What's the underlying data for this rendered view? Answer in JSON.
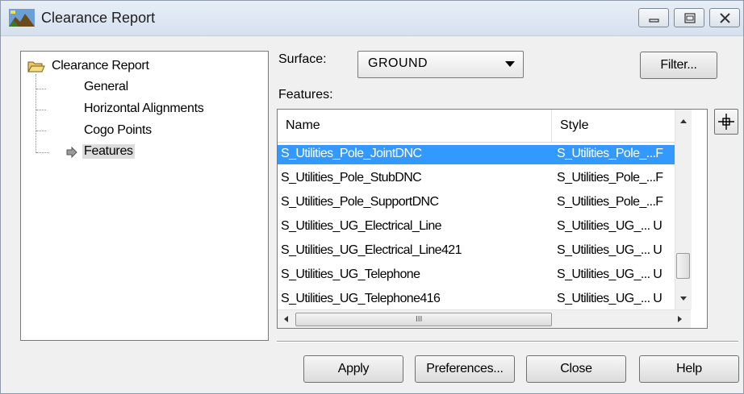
{
  "window": {
    "title": "Clearance Report"
  },
  "tree": {
    "root": "Clearance Report",
    "items": [
      "General",
      "Horizontal Alignments",
      "Cogo Points",
      "Features"
    ],
    "selected": "Features"
  },
  "surface": {
    "label": "Surface:",
    "value": "GROUND"
  },
  "features": {
    "label": "Features:",
    "columns": [
      "Name",
      "Style"
    ],
    "rows": [
      {
        "name": "S_Utilities_Pole_JointDNC",
        "style": "S_Utilities_Pole_...F",
        "selected": true
      },
      {
        "name": "S_Utilities_Pole_StubDNC",
        "style": "S_Utilities_Pole_...F"
      },
      {
        "name": "S_Utilities_Pole_SupportDNC",
        "style": "S_Utilities_Pole_...F"
      },
      {
        "name": "S_Utilities_UG_Electrical_Line",
        "style": "S_Utilities_UG_... U"
      },
      {
        "name": "S_Utilities_UG_Electrical_Line421",
        "style": "S_Utilities_UG_... U"
      },
      {
        "name": "S_Utilities_UG_Telephone",
        "style": "S_Utilities_UG_... U"
      },
      {
        "name": "S_Utilities_UG_Telephone416",
        "style": "S_Utilities_UG_... U"
      }
    ]
  },
  "buttons": {
    "filter": "Filter...",
    "apply": "Apply",
    "preferences": "Preferences...",
    "close": "Close",
    "help": "Help"
  },
  "scroll_grip": "III",
  "colors": {
    "selection": "#3399ff",
    "dialog_bg": "#f0f0f0"
  }
}
